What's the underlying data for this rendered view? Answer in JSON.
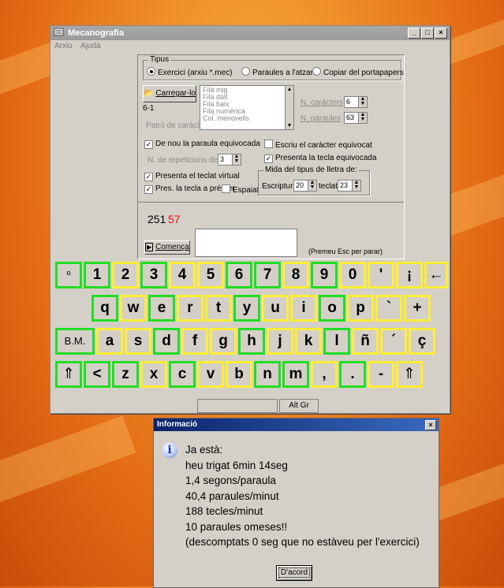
{
  "window": {
    "title": "Mecanografia",
    "menu": [
      "Arxiu",
      "Ajuda"
    ],
    "controls": [
      "_",
      "□",
      "×"
    ]
  },
  "tipus": {
    "label": "Tipus",
    "options": [
      "Exercici (arxiu *.mec)",
      "Paraules a l'atzar",
      "Copiar del portapapers"
    ],
    "selected": 0
  },
  "load_button": "Carregar-lo",
  "exercise_code": "6-1",
  "pattern_label": "Patró de caràcters",
  "list_items": [
    "Fila mig",
    "Fila dalt",
    "Fila baix",
    "Fila numèrica",
    "Col. menovells"
  ],
  "n_caracters": {
    "label": "N. caràcters",
    "value": "6"
  },
  "n_paraules": {
    "label": "N. paraules",
    "value": "63"
  },
  "options": {
    "retry_word": "De nou la paraula equivocada",
    "repetitions_label": "N. de repeticions de línia",
    "repetitions_value": "3",
    "virtual_keyboard": "Presenta el teclat virtual",
    "press_key": "Pres. la tecla a prémer",
    "space": "Espaiat",
    "write_wrong": "Escriu el caràcter equivocat",
    "show_wrong_key": "Presenta la tecla equivocada"
  },
  "font_size": {
    "label": "Mida del tipus de lletra de:",
    "writing_label": "Escriptura",
    "writing_value": "20",
    "keyboard_label": "teclat",
    "keyboard_value": "23"
  },
  "stats": {
    "total": "251",
    "errors": "57"
  },
  "start_button": "Comença",
  "esc_hint": "(Premeu Esc per parar)",
  "keyboard": {
    "rows": [
      [
        "º",
        "1",
        "2",
        "3",
        "4",
        "5",
        "6",
        "7",
        "8",
        "9",
        "0",
        "'",
        "¡",
        "←"
      ],
      [
        "q",
        "w",
        "e",
        "r",
        "t",
        "y",
        "u",
        "i",
        "o",
        "p",
        "`",
        "+"
      ],
      [
        "B.M.",
        "a",
        "s",
        "d",
        "f",
        "g",
        "h",
        "j",
        "k",
        "l",
        "ñ",
        "´",
        "ç"
      ],
      [
        "⇑",
        "<",
        "z",
        "x",
        "c",
        "v",
        "b",
        "n",
        "m",
        ",",
        ".",
        "-",
        "⇑"
      ]
    ],
    "altgr": "Alt Gr",
    "highlight_green": "#22dd22",
    "highlight_yellow": "#ffee33"
  },
  "dialog": {
    "title": "Informació",
    "close": "×",
    "lines": [
      "Ja està:",
      "heu trigat 6min 14seg",
      "1,4 segons/paraula",
      "40,4 paraules/minut",
      "188 tecles/minut",
      "10 paraules omeses!!",
      "(descomptats 0 seg que no estàveu per l'exercici)"
    ],
    "ok": "D'acord"
  }
}
